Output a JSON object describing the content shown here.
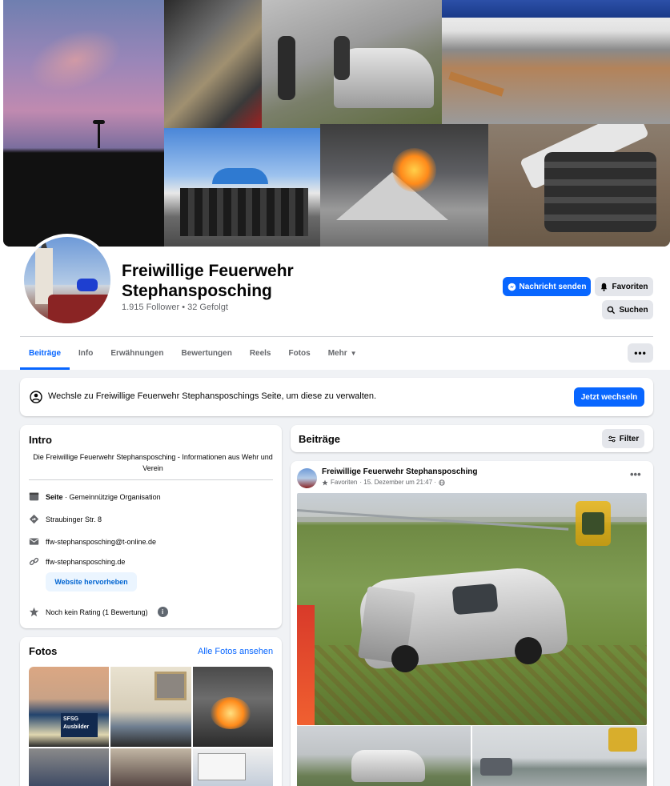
{
  "page": {
    "name": "Freiwillige Feuerwehr Stephansposching",
    "followers": "1.915 Follower • 32 Gefolgt"
  },
  "actions": {
    "message": "Nachricht senden",
    "favorites": "Favoriten",
    "search": "Suchen"
  },
  "tabs": [
    {
      "label": "Beiträge",
      "active": true
    },
    {
      "label": "Info"
    },
    {
      "label": "Erwähnungen"
    },
    {
      "label": "Bewertungen"
    },
    {
      "label": "Reels"
    },
    {
      "label": "Fotos"
    },
    {
      "label": "Mehr"
    }
  ],
  "more_button": "•••",
  "banner": {
    "text": "Wechsle zu Freiwillige Feuerwehr Stephansposchings Seite, um diese zu verwalten.",
    "button": "Jetzt wechseln"
  },
  "intro": {
    "title": "Intro",
    "description": "Die Freiwillige Feuerwehr Stephansposching - Informationen aus Wehr und Verein",
    "rows": {
      "category_bold": "Seite",
      "category": " · Gemeinnützige Organisation",
      "address": "Straubinger Str. 8",
      "email": "ffw-stephansposching@t-online.de",
      "website": "ffw-stephansposching.de",
      "rating": "Noch kein Rating (1 Bewertung)"
    },
    "highlight_button": "Website hervorheben",
    "info_icon": "i"
  },
  "photos": {
    "title": "Fotos",
    "see_all": "Alle Fotos ansehen",
    "badge_text": "SFSG Ausbilder"
  },
  "posts": {
    "title": "Beiträge",
    "filter": "Filter",
    "post": {
      "author": "Freiwillige Feuerwehr Stephansposching",
      "audience": "Favoriten",
      "time": "· 15. Dezember um 21:47 ·",
      "menu": "•••"
    }
  },
  "colors": {
    "accent": "#0866ff",
    "background": "#f0f2f5",
    "card": "#ffffff",
    "secondary_text": "#65676b"
  },
  "icons": [
    "messenger-icon",
    "bell-icon",
    "search-icon",
    "switch-profile-icon",
    "page-icon",
    "address-icon",
    "email-icon",
    "link-icon",
    "star-icon",
    "info-icon",
    "filter-icon",
    "globe-icon"
  ]
}
